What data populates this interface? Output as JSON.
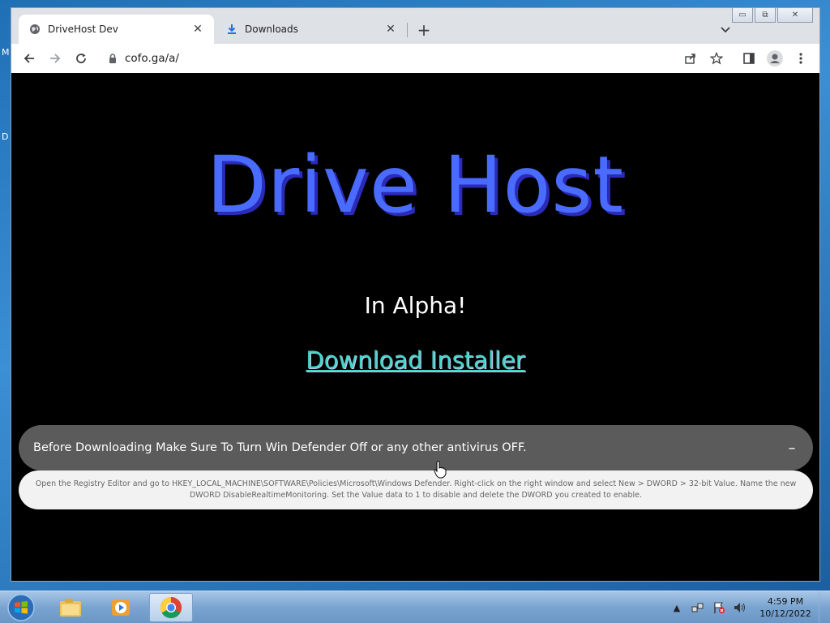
{
  "desktop": {
    "glyph_top": "M",
    "glyph_mid": "D"
  },
  "browser": {
    "tabs": [
      {
        "title": "DriveHost Dev",
        "icon": "globe-icon",
        "active": true
      },
      {
        "title": "Downloads",
        "icon": "download-icon",
        "active": false
      }
    ],
    "new_tab_label": "+",
    "address": "cofo.ga/a/",
    "window_controls": {
      "minimize": "▭",
      "maximize": "⧉",
      "close": "✕"
    }
  },
  "page": {
    "hero_title": "Drive Host",
    "subtitle": "In Alpha!",
    "download_link": "Download Installer",
    "accordion": {
      "title": "Before Downloading Make Sure To Turn Win Defender Off or any other antivirus OFF.",
      "toggle": "–",
      "body": "Open the Registry Editor and go to HKEY_LOCAL_MACHINE\\SOFTWARE\\Policies\\Microsoft\\Windows Defender. Right-click on the right window and select New > DWORD > 32-bit Value. Name the new DWORD DisableRealtimeMonitoring. Set the Value data to 1 to disable and delete the DWORD you created to enable."
    }
  },
  "taskbar": {
    "apps": [
      "explorer-icon",
      "media-player-icon",
      "chrome-icon"
    ],
    "time": "4:59 PM",
    "date": "10/12/2022"
  },
  "colors": {
    "hero": "#4a6bff",
    "hero_shadow": "#2b2bb8",
    "link": "#3fd6c8",
    "accordion_bg": "#5b5b5b"
  }
}
